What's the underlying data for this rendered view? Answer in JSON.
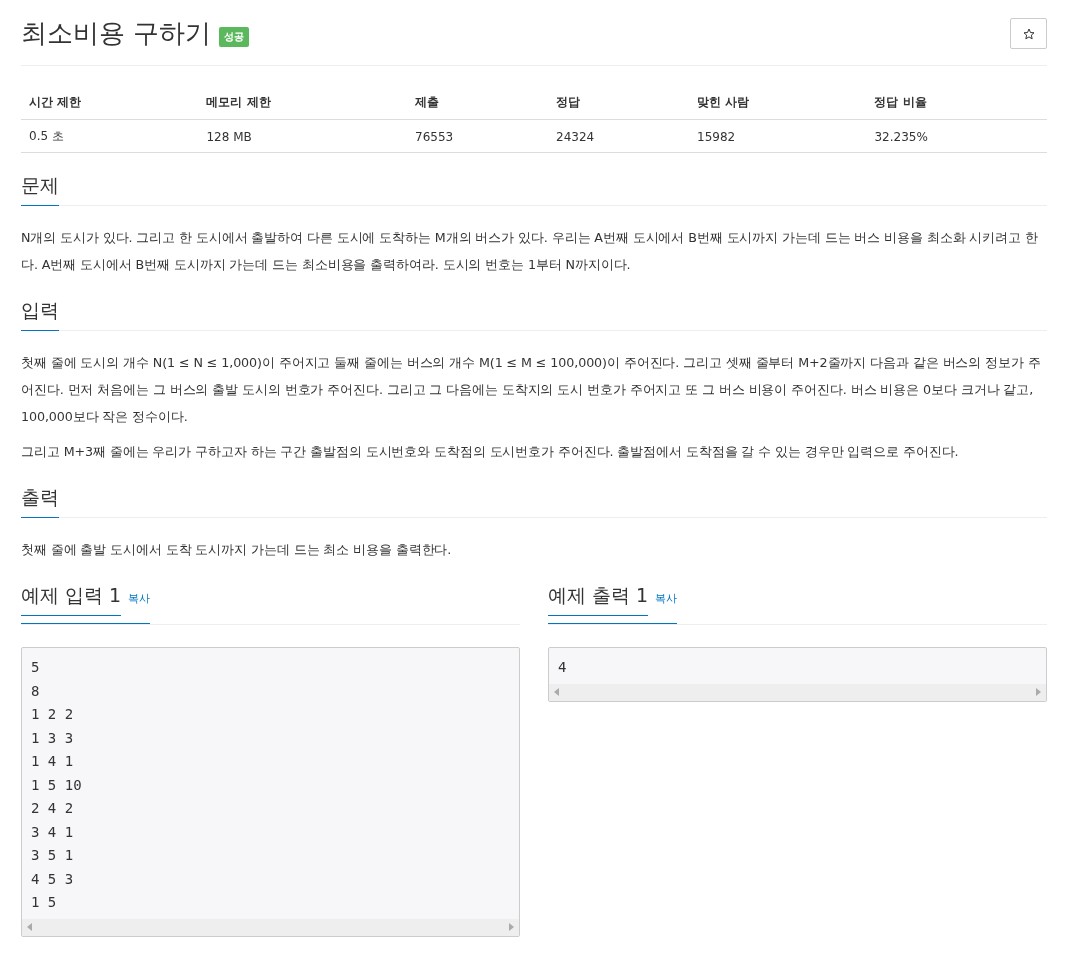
{
  "title": "최소비용 구하기",
  "result_badge": "성공",
  "stats": {
    "columns": [
      "시간 제한",
      "메모리 제한",
      "제출",
      "정답",
      "맞힌 사람",
      "정답 비율"
    ],
    "values": [
      "0.5 초",
      "128 MB",
      "76553",
      "24324",
      "15982",
      "32.235%"
    ]
  },
  "sections": [
    {
      "heading": "문제",
      "paragraphs": [
        "N개의 도시가 있다. 그리고 한 도시에서 출발하여 다른 도시에 도착하는 M개의 버스가 있다. 우리는 A번째 도시에서 B번째 도시까지 가는데 드는 버스 비용을 최소화 시키려고 한다. A번째 도시에서 B번째 도시까지 가는데 드는 최소비용을 출력하여라. 도시의 번호는 1부터 N까지이다."
      ]
    },
    {
      "heading": "입력",
      "paragraphs": [
        "첫째 줄에 도시의 개수 N(1 ≤ N ≤ 1,000)이 주어지고 둘째 줄에는 버스의 개수 M(1 ≤ M ≤ 100,000)이 주어진다. 그리고 셋째 줄부터 M+2줄까지 다음과 같은 버스의 정보가 주어진다. 먼저 처음에는 그 버스의 출발 도시의 번호가 주어진다. 그리고 그 다음에는 도착지의 도시 번호가 주어지고 또 그 버스 비용이 주어진다. 버스 비용은 0보다 크거나 같고, 100,000보다 작은 정수이다.",
        "그리고 M+3째 줄에는 우리가 구하고자 하는 구간 출발점의 도시번호와 도착점의 도시번호가 주어진다. 출발점에서 도착점을 갈 수 있는 경우만 입력으로 주어진다."
      ]
    },
    {
      "heading": "출력",
      "paragraphs": [
        "첫째 줄에 출발 도시에서 도착 도시까지 가는데 드는 최소 비용을 출력한다."
      ]
    }
  ],
  "samples": [
    {
      "heading": "예제 입력 1",
      "copy_link": "복사",
      "lines": [
        "5",
        "8",
        "1 2 2",
        "1 3 3",
        "1 4 1",
        "1 5 10",
        "2 4 2",
        "3 4 1",
        "3 5 1",
        "4 5 3",
        "1 5"
      ]
    },
    {
      "heading": "예제 출력 1",
      "copy_link": "복사",
      "lines": [
        "4"
      ]
    }
  ]
}
